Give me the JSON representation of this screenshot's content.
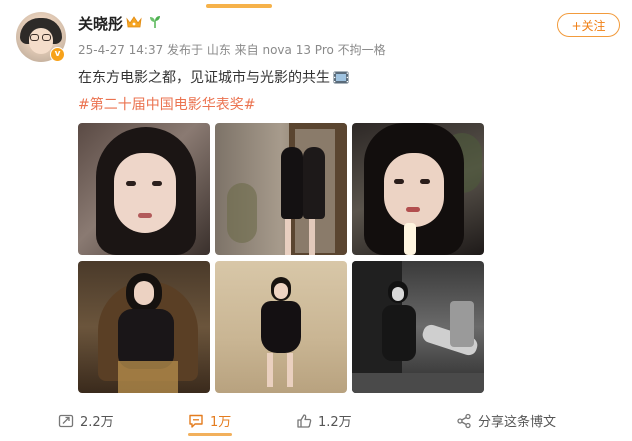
{
  "post": {
    "username": "关晓彤",
    "meta": "25-4-27 14:37  发布于 山东  来自 nova 13 Pro 不拘一格",
    "text": "在东方电影之都，见证城市与光影的共生",
    "hashtag": "#第二十届中国电影华表奖#",
    "follow_label": "+关注",
    "photo_count": 6
  },
  "actions": {
    "repost": "2.2万",
    "comment": "1万",
    "like": "1.2万",
    "share": "分享这条博文"
  },
  "colors": {
    "accent": "#f07f14",
    "hashtag": "#eb7350",
    "meta": "#8a8a8a",
    "badge": "#f7a21a"
  },
  "icons": [
    "verified-badge-icon",
    "crown-icon",
    "sprout-icon",
    "film-icon",
    "repost-icon",
    "comment-icon",
    "like-icon",
    "share-icon"
  ]
}
